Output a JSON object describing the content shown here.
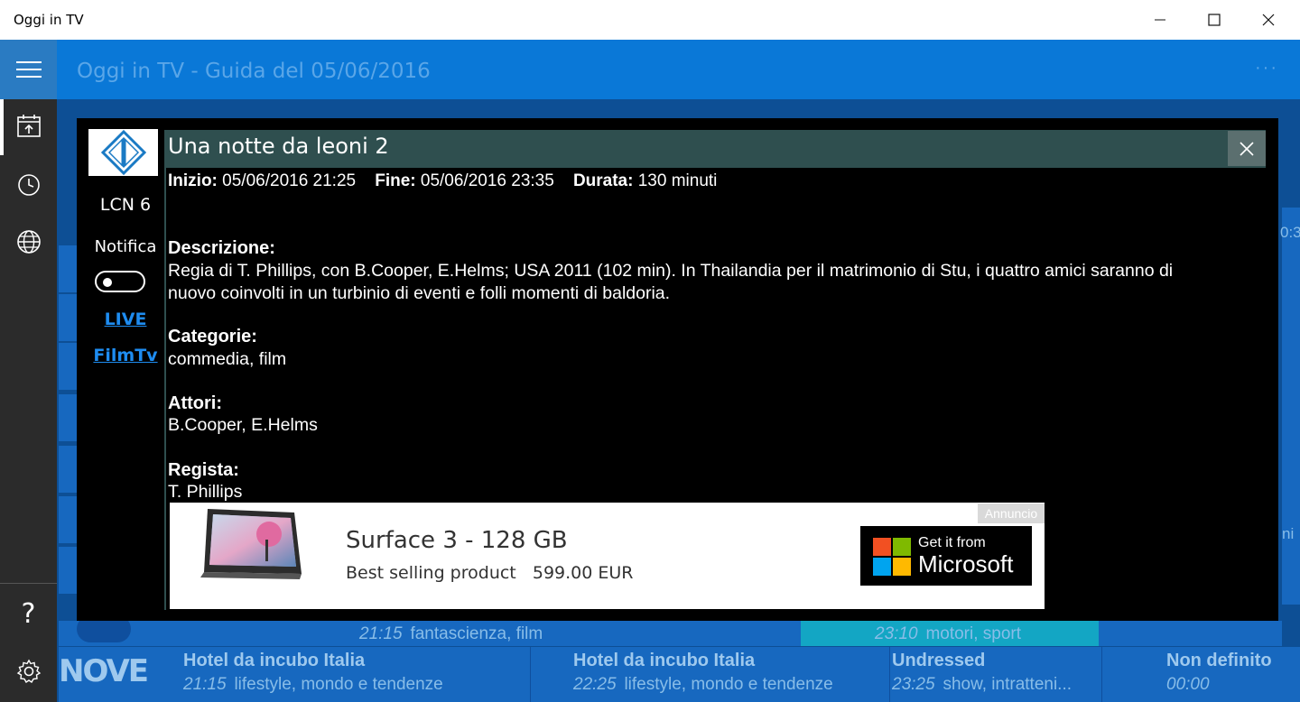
{
  "window": {
    "title": "Oggi in TV",
    "minimize_icon": "minimize-icon",
    "maximize_icon": "maximize-icon",
    "close_icon": "close-icon"
  },
  "appbar": {
    "title": "Oggi in TV - Guida del 05/06/2016",
    "more": "···",
    "accent": "#0a78d7"
  },
  "nav": {
    "items": [
      {
        "icon": "calendar-icon"
      },
      {
        "icon": "clock-icon"
      },
      {
        "icon": "globe-icon"
      }
    ],
    "bottom": [
      {
        "icon": "help-icon",
        "label": "?"
      },
      {
        "icon": "gear-icon"
      }
    ]
  },
  "dialog": {
    "lcn": "LCN 6",
    "notifica": "Notifica",
    "live": "LIVE",
    "filmtv": "FilmTv",
    "title": "Una notte da leoni 2",
    "inizio_label": "Inizio:",
    "inizio_value": "05/06/2016 21:25",
    "fine_label": "Fine:",
    "fine_value": "05/06/2016 23:35",
    "durata_label": "Durata:",
    "durata_value": "130 minuti",
    "descrizione_label": "Descrizione:",
    "descrizione_line1": "Regia di T. Phillips, con B.Cooper, E.Helms; USA 2011 (102 min). In Thailandia per il matrimonio di Stu, i quattro amici saranno di",
    "descrizione_line2": "nuovo coinvolti in un turbinio di eventi e folli momenti di baldoria.",
    "categorie_label": "Categorie:",
    "categorie_value": "commedia, film",
    "attori_label": "Attori:",
    "attori_value": "B.Cooper, E.Helms",
    "regista_label": "Regista:",
    "regista_value": "T. Phillips"
  },
  "ad": {
    "tag": "Annuncio",
    "title": "Surface 3 - 128 GB",
    "subtitle": "Best selling product   599.00 EUR",
    "badge_line1": "Get it from",
    "badge_line2": "Microsoft"
  },
  "guide_bottom": {
    "row1": [
      {
        "time": "21:15",
        "category": "fantascienza, film"
      },
      {
        "time": "23:10",
        "category": "motori, sport"
      }
    ],
    "row2_channel": "NOVE",
    "row2": [
      {
        "title": "Hotel da incubo Italia",
        "time": "21:15",
        "category": "lifestyle, mondo e tendenze"
      },
      {
        "title": "Hotel da incubo Italia",
        "time": "22:25",
        "category": "lifestyle, mondo e tendenze"
      },
      {
        "title": "Undressed",
        "time": "23:25",
        "category": "show, intratteni..."
      },
      {
        "title": "Non definito",
        "time": "00:00",
        "category": ""
      }
    ],
    "edge_text_1": "0:3",
    "edge_text_2": "ni"
  }
}
